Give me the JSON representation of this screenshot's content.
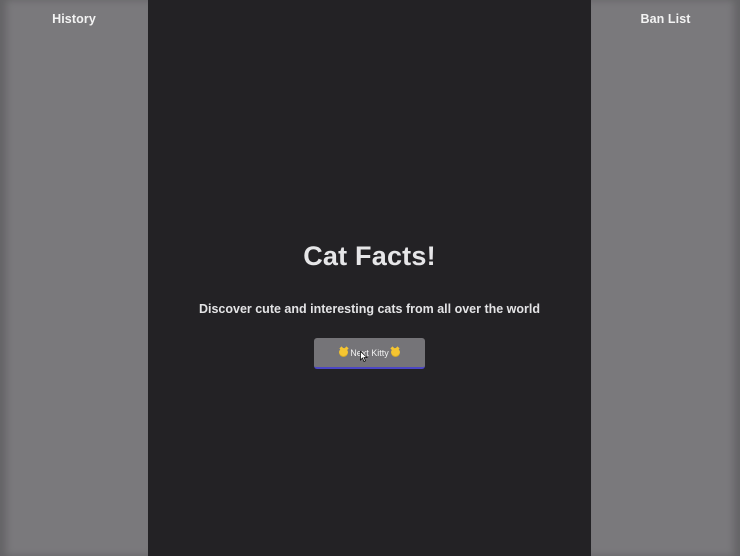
{
  "left_sidebar": {
    "title": "History"
  },
  "right_sidebar": {
    "title": "Ban List"
  },
  "main": {
    "title": "Cat Facts!",
    "subtitle": "Discover cute and interesting cats from all over the world",
    "next_button": {
      "label": "Next Kitty",
      "icon": "cat-face-emoji"
    }
  },
  "colors": {
    "sidebar_bg": "#7a797c",
    "main_bg": "#232225",
    "button_bg": "#757478",
    "button_accent": "#4b46c4"
  }
}
